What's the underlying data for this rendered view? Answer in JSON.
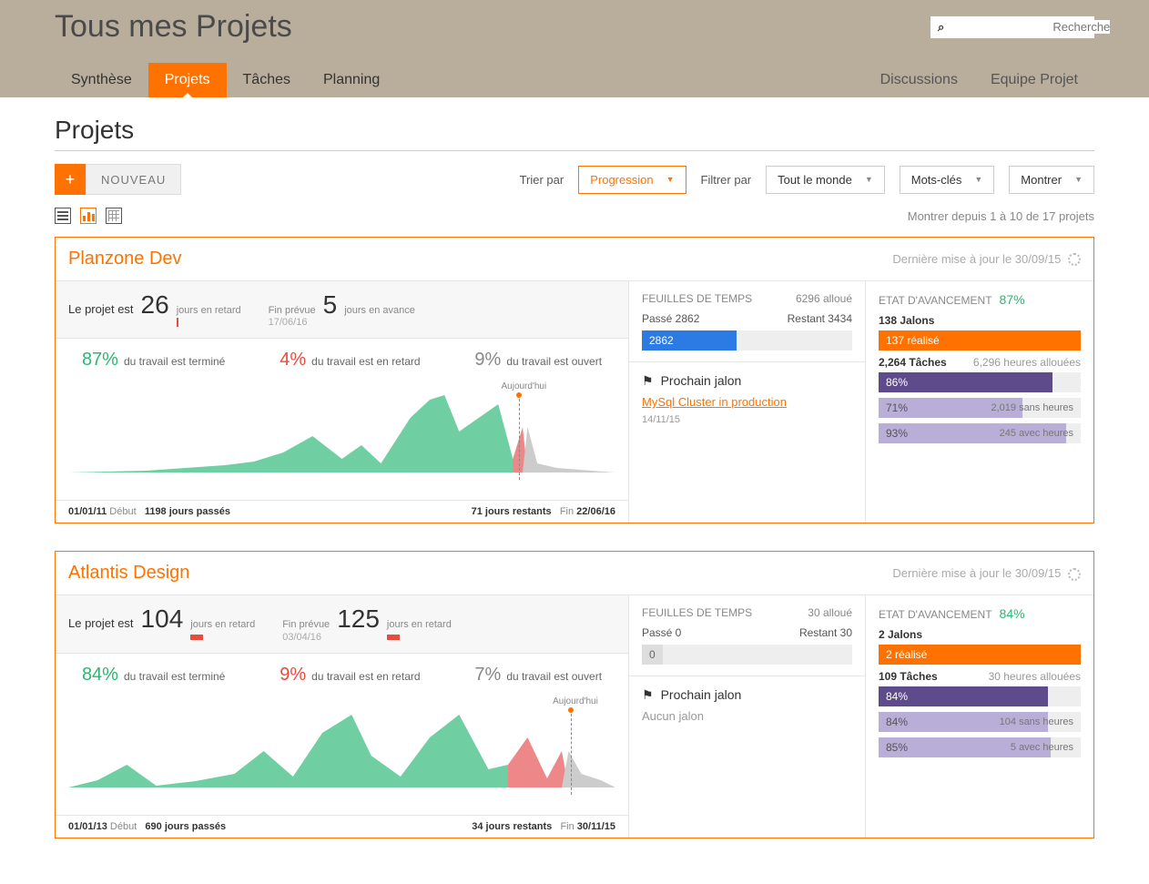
{
  "header": {
    "title": "Tous mes Projets",
    "search_placeholder": "Recherche",
    "tabs_left": [
      "Synthèse",
      "Projets",
      "Tâches",
      "Planning"
    ],
    "active_tab": "Projets",
    "tabs_right": [
      "Discussions",
      "Equipe Projet"
    ]
  },
  "section": {
    "title": "Projets",
    "new_button": "NOUVEAU",
    "sort_label": "Trier par",
    "sort_value": "Progression",
    "filter_label": "Filtrer par",
    "filter_people": "Tout le monde",
    "filter_keywords": "Mots-clés",
    "show_label": "Montrer",
    "count_text": "Montrer depuis 1 à 10 de 17 projets"
  },
  "projects": [
    {
      "name": "Planzone Dev",
      "updated": "Dernière mise à jour le 30/09/15",
      "status_label": "Le projet est",
      "late_days": "26",
      "late_text": "jours en retard",
      "end_label": "Fin prévue",
      "end_sub": "17/06/16",
      "lead_days": "5",
      "lead_text": "jours en avance",
      "work_done_pct": "87%",
      "work_done_text": "du travail est terminé",
      "work_late_pct": "4%",
      "work_late_text": "du travail est en retard",
      "work_open_pct": "9%",
      "work_open_text": "du travail est ouvert",
      "today_label": "Aujourd'hui",
      "timeline_start": "01/01/11",
      "timeline_start_label": "Début",
      "timeline_passed": "1198 jours passés",
      "timeline_remaining": "71 jours restants",
      "timeline_end_label": "Fin",
      "timeline_end": "22/06/16",
      "timesheet_title": "FEUILLES DE TEMPS",
      "timesheet_alloc": "6296 alloué",
      "time_past_label": "Passé 2862",
      "time_rem_label": "Restant 3434",
      "time_bar_val": "2862",
      "time_bar_pct": 45,
      "milestone_title": "Prochain jalon",
      "milestone_link": "MySql Cluster in production",
      "milestone_date": "14/11/15",
      "milestone_none": "",
      "progress_title": "ETAT D'AVANCEMENT",
      "progress_pct": "87%",
      "jalons_count": "138 Jalons",
      "jalons_done": "137 réalisé",
      "tasks_count": "2,264 Tâches",
      "tasks_hours": "6,296 heures allouées",
      "tasks_pct": "86%",
      "tasks_pct_w": 86,
      "no_hours_pct": "71%",
      "no_hours_text": "2,019 sans heures",
      "no_hours_w": 71,
      "with_hours_pct": "93%",
      "with_hours_text": "245 avec heures",
      "with_hours_w": 93
    },
    {
      "name": "Atlantis Design",
      "updated": "Dernière mise à jour le 30/09/15",
      "status_label": "Le projet est",
      "late_days": "104",
      "late_text": "jours en retard",
      "end_label": "Fin prévue",
      "end_sub": "03/04/16",
      "lead_days": "125",
      "lead_text": "jours en retard",
      "work_done_pct": "84%",
      "work_done_text": "du travail est terminé",
      "work_late_pct": "9%",
      "work_late_text": "du travail est en retard",
      "work_open_pct": "7%",
      "work_open_text": "du travail est ouvert",
      "today_label": "Aujourd'hui",
      "timeline_start": "01/01/13",
      "timeline_start_label": "Début",
      "timeline_passed": "690 jours passés",
      "timeline_remaining": "34 jours restants",
      "timeline_end_label": "Fin",
      "timeline_end": "30/11/15",
      "timesheet_title": "FEUILLES DE TEMPS",
      "timesheet_alloc": "30 alloué",
      "time_past_label": "Passé 0",
      "time_rem_label": "Restant 30",
      "time_bar_val": "0",
      "time_bar_pct": 0,
      "milestone_title": "Prochain jalon",
      "milestone_link": "",
      "milestone_date": "",
      "milestone_none": "Aucun jalon",
      "progress_title": "ETAT D'AVANCEMENT",
      "progress_pct": "84%",
      "jalons_count": "2 Jalons",
      "jalons_done": "2 réalisé",
      "tasks_count": "109 Tâches",
      "tasks_hours": "30 heures allouées",
      "tasks_pct": "84%",
      "tasks_pct_w": 84,
      "no_hours_pct": "84%",
      "no_hours_text": "104 sans heures",
      "no_hours_w": 84,
      "with_hours_pct": "85%",
      "with_hours_text": "5 avec heures",
      "with_hours_w": 85
    }
  ],
  "chart_data": [
    {
      "type": "area",
      "project": "Planzone Dev",
      "x_range": [
        "01/01/11",
        "22/06/16"
      ],
      "today_position_pct": 81,
      "series": [
        {
          "name": "terminé",
          "color": "#6fcfa3"
        },
        {
          "name": "retard",
          "color": "#e88"
        },
        {
          "name": "ouvert",
          "color": "#ccc"
        }
      ],
      "note": "Irregular workload area chart; peak activity near today marker"
    },
    {
      "type": "area",
      "project": "Atlantis Design",
      "x_range": [
        "01/01/13",
        "30/11/15"
      ],
      "today_position_pct": 90,
      "series": [
        {
          "name": "terminé",
          "color": "#6fcfa3"
        },
        {
          "name": "retard",
          "color": "#e88"
        },
        {
          "name": "ouvert",
          "color": "#ccc"
        }
      ],
      "note": "Multi-peak area chart with late (red) segments after ~80%"
    }
  ]
}
